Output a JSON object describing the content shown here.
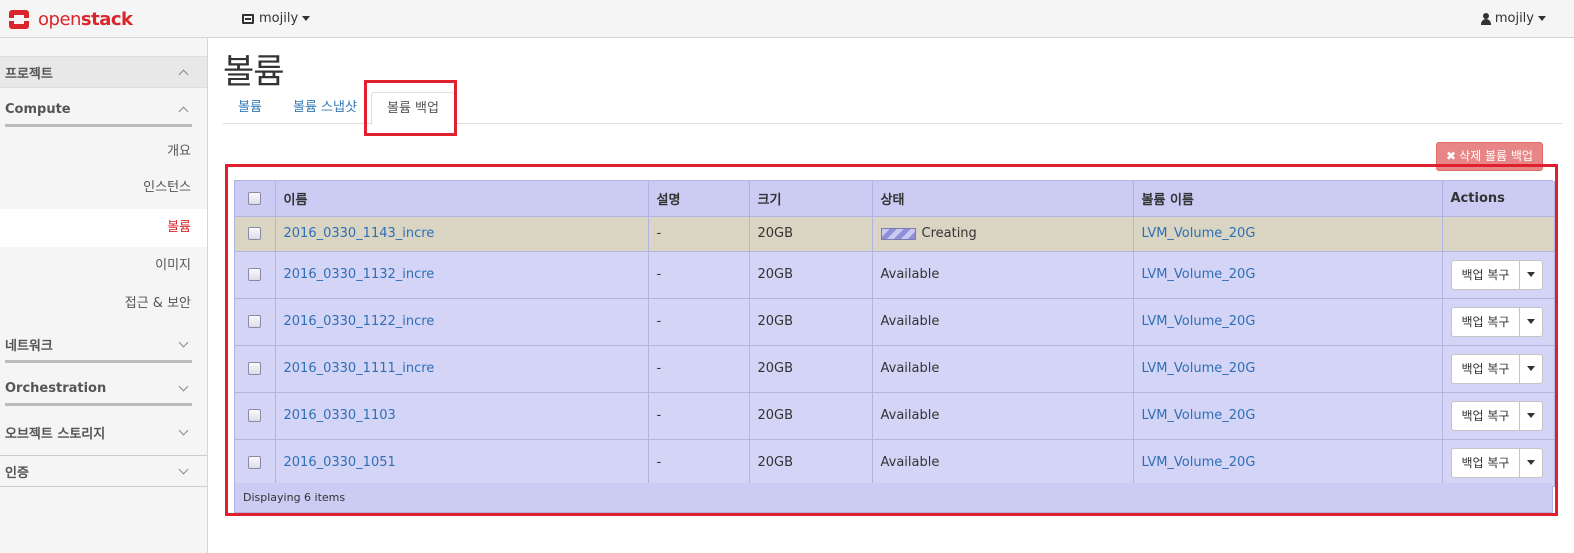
{
  "navbar": {
    "brand_open": "open",
    "brand_stack": "stack",
    "project": "mojily",
    "user": "mojily"
  },
  "sidebar": {
    "project_section": "프로젝트",
    "compute_section": "Compute",
    "compute_items": [
      "개요",
      "인스턴스",
      "볼륨",
      "이미지",
      "접근 & 보안"
    ],
    "active_item": "볼륨",
    "network_section": "네트워크",
    "orchestration_section": "Orchestration",
    "object_storage_section": "오브젝트 스토리지",
    "identity_section": "인증"
  },
  "main": {
    "title": "볼륨",
    "tabs": [
      "볼륨",
      "볼륨 스냅샷",
      "볼륨 백업"
    ],
    "active_tab": "볼륨 백업",
    "delete_button": "삭제 볼륨 백업",
    "table": {
      "headers": [
        "이름",
        "설명",
        "크기",
        "상태",
        "볼륨 이름",
        "Actions"
      ],
      "rows": [
        {
          "name": "2016_0330_1143_incre",
          "description": "-",
          "size": "20GB",
          "status": "Creating",
          "volume": "LVM_Volume_20G",
          "action": ""
        },
        {
          "name": "2016_0330_1132_incre",
          "description": "-",
          "size": "20GB",
          "status": "Available",
          "volume": "LVM_Volume_20G",
          "action": "백업 복구"
        },
        {
          "name": "2016_0330_1122_incre",
          "description": "-",
          "size": "20GB",
          "status": "Available",
          "volume": "LVM_Volume_20G",
          "action": "백업 복구"
        },
        {
          "name": "2016_0330_1111_incre",
          "description": "-",
          "size": "20GB",
          "status": "Available",
          "volume": "LVM_Volume_20G",
          "action": "백업 복구"
        },
        {
          "name": "2016_0330_1103",
          "description": "-",
          "size": "20GB",
          "status": "Available",
          "volume": "LVM_Volume_20G",
          "action": "백업 복구"
        },
        {
          "name": "2016_0330_1051",
          "description": "-",
          "size": "20GB",
          "status": "Available",
          "volume": "LVM_Volume_20G",
          "action": "백업 복구"
        }
      ],
      "footer": "Displaying 6 items"
    }
  },
  "colors": {
    "brand_red": "#d9262c",
    "link_blue": "#2f6fb5",
    "highlight_red": "#e0202f",
    "table_bg": "#d4d4f7",
    "creating_row_bg": "#d9d5c2"
  }
}
